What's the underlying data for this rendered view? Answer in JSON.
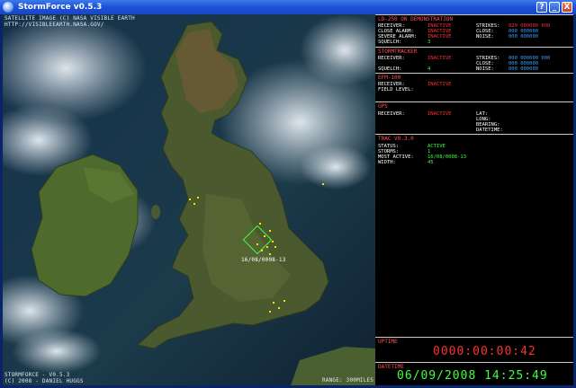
{
  "window": {
    "title": "StormForce v0.5.3",
    "buttons": [
      "?",
      "_",
      "X"
    ]
  },
  "map": {
    "credit_line1": "SATELLITE IMAGE (C) NASA VISIBLE EARTH",
    "credit_line2": "HTTP://VISIBLEEARTH.NASA.GOV/",
    "brand_line1": "STORMFORCE - V0.5.3",
    "brand_line2": "(C) 2008 - DANIEL HUGGS",
    "range": "RANGE: 300MILES",
    "strike_label": "16/08/0008-13"
  },
  "panel": {
    "ld250": {
      "title": "LD-250 ON DEMONSTRATION",
      "receiver_label": "RECEIVER:",
      "receiver_value": "INACTIVE",
      "close_alarm_label": "CLOSE ALARM:",
      "close_alarm_value": "INACTIVE",
      "severe_alarm_label": "SEVERE ALARM:",
      "severe_alarm_value": "INACTIVE",
      "squelch_label": "SQUELCH:",
      "squelch_value": "3",
      "strikes_label": "STRIKES:",
      "strikes_value": "029 000000 000",
      "close_label": "CLOSE:",
      "close_value": "000 000000",
      "noise_label": "NOISE:",
      "noise_value": "000 000000"
    },
    "stormtracker": {
      "title": "STORMTRACKER",
      "receiver_label": "RECEIVER:",
      "receiver_value": "INACTIVE",
      "squelch_label": "SQUELCH:",
      "squelch_value": "4",
      "strikes_label": "STRIKES:",
      "strikes_value": "000 000000 000",
      "close_label": "CLOSE:",
      "close_value": "000 000000",
      "noise_label": "NOISE:",
      "noise_value": "000 000000"
    },
    "efm100": {
      "title": "EFM-100",
      "receiver_label": "RECEIVER:",
      "receiver_value": "INACTIVE",
      "field_level_label": "FIELD LEVEL:"
    },
    "gps": {
      "title": "GPS",
      "receiver_label": "RECEIVER:",
      "receiver_value": "INACTIVE",
      "lat_label": "LAT:",
      "long_label": "LONG:",
      "bearing_label": "BEARING:",
      "datetime_label": "DATETIME:"
    },
    "trac": {
      "title": "TRAC V0.3.0",
      "status_label": "STATUS:",
      "status_value": "ACTIVE",
      "storms_label": "STORMS:",
      "storms_value": "1",
      "most_active_label": "MOST ACTIVE:",
      "most_active_value": "16/08/0008-13",
      "width_label": "WIDTH:",
      "width_value": "45"
    },
    "uptime": {
      "title": "UPTIME",
      "value": "0000:00:00:42"
    },
    "datetime": {
      "title": "DATETIME",
      "value": "06/09/2008 14:25:49"
    }
  },
  "colors": {
    "inactive": "#ff3030",
    "counter": "#3aa0ff",
    "active": "#40ff40",
    "strike": "#ffe000"
  }
}
